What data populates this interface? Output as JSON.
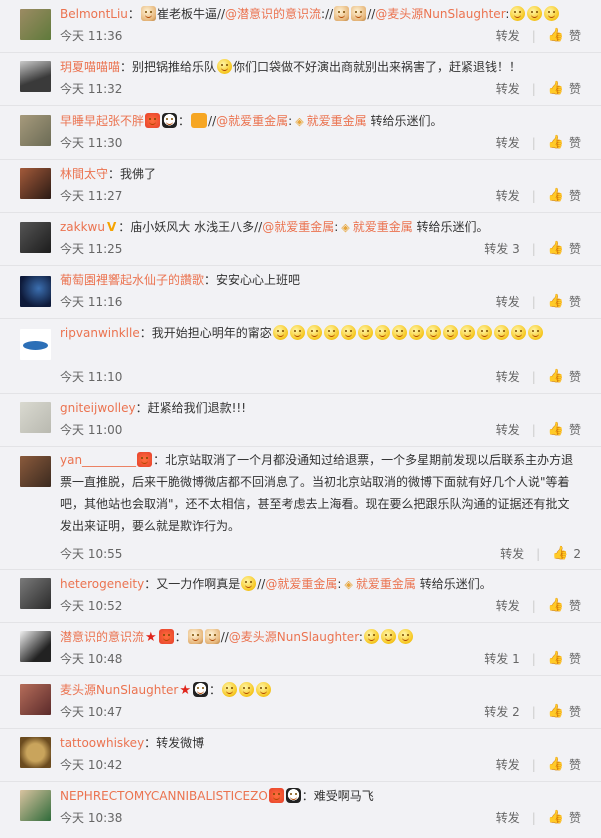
{
  "colors": {
    "username": "#eb7350",
    "mention": "#eb7350",
    "background": "#f2f2f5"
  },
  "comments": [
    {
      "user": "BelmontLiu",
      "parts": [
        "崔老板牛逼//",
        "@潜意识的意识流",
        "://",
        "@麦头源NunSlaughter",
        ":"
      ],
      "time": "今天 11:36",
      "repost": "转发",
      "like": "赞",
      "avatar": [
        "#9c8b63",
        "#5f7a3b"
      ]
    },
    {
      "user": "玥夏喵喵喵",
      "parts": [
        "别把锅推给乐队",
        "你们口袋做不好演出商就别出来祸害了，赶紧退钱！！"
      ],
      "time": "今天 11:32",
      "repost": "转发",
      "like": "赞",
      "avatar": [
        "#3a3a3a",
        "#c9c9c9"
      ]
    },
    {
      "user": "早睡早起张不胖",
      "parts": [
        "//",
        "@就爱重金属",
        ":",
        "就爱重金属",
        " 转给乐迷们。"
      ],
      "time": "今天 11:30",
      "repost": "转发",
      "like": "赞",
      "avatar": [
        "#6b6b55",
        "#a69a7c"
      ]
    },
    {
      "user": "林間太守",
      "parts": [
        "：我佛了"
      ],
      "time": "今天 11:27",
      "repost": "转发",
      "like": "赞",
      "avatar": [
        "#2b1a14",
        "#a35a3a"
      ]
    },
    {
      "user": "zakkwu",
      "parts": [
        "：庙小妖风大 水浅王八多//",
        "@就爱重金属",
        ":",
        "就爱重金属",
        " 转给乐迷们。"
      ],
      "time": "今天 11:25",
      "repost": "转发 3",
      "like": "赞",
      "avatar": [
        "#1c1c1c",
        "#555"
      ]
    },
    {
      "user": "葡萄園裡響起水仙子的讚歌",
      "parts": [
        "：安安心心上班吧"
      ],
      "time": "今天 11:16",
      "repost": "转发",
      "like": "赞",
      "avatar": [
        "#0e1a3a",
        "#3b6fb0"
      ]
    },
    {
      "user": "ripvanwinklle",
      "parts": [
        "：我开始担心明年的甯宓"
      ],
      "time": "今天 11:10",
      "repost": "转发",
      "like": "赞",
      "avatar": [
        "#ffffff",
        "#2c6fb7"
      ]
    },
    {
      "user": "gniteijwolley",
      "parts": [
        "：赶紧给我们退款!!!"
      ],
      "time": "今天 11:00",
      "repost": "转发",
      "like": "赞",
      "avatar": [
        "#b9b9b0",
        "#d9d9d0"
      ]
    },
    {
      "user": "yan_________",
      "parts": [
        "：北京站取消了一个月都没通知过给退票，一个多星期前发现以后联系主办方退票一直推脱，后来干脆微博微店都不回消息了。当初北京站取消的微博下面就有好几个人说\"等着吧，其他站也会取消\"，还不太相信，甚至考虑去上海看。现在要么把跟乐队沟通的证据还有批文发出来证明，要么就是欺诈行为。"
      ],
      "time": "今天 10:55",
      "repost": "转发",
      "like": "2",
      "avatar": [
        "#3b2a1f",
        "#8a5a3c"
      ]
    },
    {
      "user": "heterogeneity",
      "parts": [
        "：又一力作啊真是",
        "//",
        "@就爱重金属",
        ":",
        "就爱重金属",
        " 转给乐迷们。"
      ],
      "time": "今天 10:52",
      "repost": "转发",
      "like": "赞",
      "avatar": [
        "#2a2a2a",
        "#7a7a7a"
      ]
    },
    {
      "user": "潜意识的意识流",
      "parts": [
        "：",
        "//",
        "@麦头源NunSlaughter",
        ":"
      ],
      "time": "今天 10:48",
      "repost": "转发 1",
      "like": "赞",
      "avatar": [
        "#f0f0f0",
        "#222"
      ]
    },
    {
      "user": "麦头源NunSlaughter",
      "parts": [
        "："
      ],
      "time": "今天 10:47",
      "repost": "转发 2",
      "like": "赞",
      "avatar": [
        "#5b2a2a",
        "#b56d5a"
      ]
    },
    {
      "user": "tattoowhiskey",
      "parts": [
        "：转发微博"
      ],
      "time": "今天 10:42",
      "repost": "转发",
      "like": "赞",
      "avatar": [
        "#c9a45c",
        "#6b4b1f"
      ]
    },
    {
      "user": "NEPHRECTOMYCANNIBALISTICEZO",
      "parts": [
        "：难受啊马飞"
      ],
      "time": "今天 10:38",
      "repost": "转发",
      "like": "赞",
      "avatar": [
        "#2f6b3a",
        "#d9c3a0"
      ]
    }
  ]
}
